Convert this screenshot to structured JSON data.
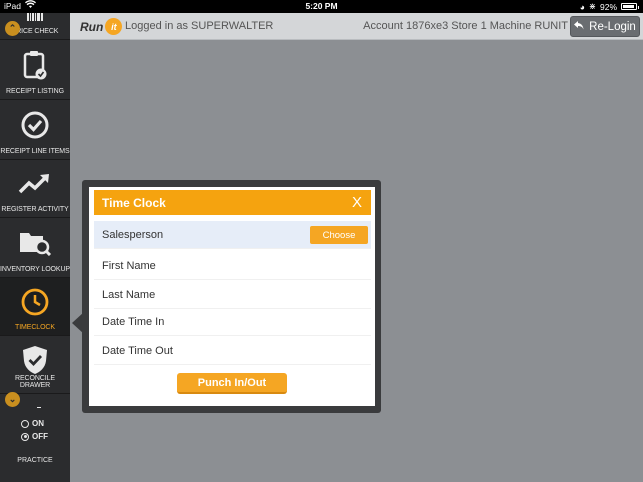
{
  "status_bar": {
    "carrier": "iPad",
    "time": "5:20 PM",
    "battery": "92%",
    "battery_level": 0.92
  },
  "header": {
    "logo_text": "Run",
    "logo_badge": "it",
    "logged_in": "Logged in as SUPERWALTER",
    "account": "Account 1876xe3 Store 1 Machine RUNIT",
    "relogin_label": "Re-Login"
  },
  "sidebar": {
    "items": [
      {
        "label": "Price Check",
        "icon": "barcode-icon"
      },
      {
        "label": "Receipt Listing",
        "icon": "clipboard-check-icon"
      },
      {
        "label": "Receipt Line Items",
        "icon": "check-circle-icon"
      },
      {
        "label": "Register Activity",
        "icon": "trend-up-icon"
      },
      {
        "label": "Inventory Lookup",
        "icon": "folder-search-icon"
      },
      {
        "label": "Timeclock",
        "icon": "clock-icon",
        "active": true
      },
      {
        "label": "Reconcile Drawer",
        "icon": "shield-check-icon"
      }
    ],
    "practice": {
      "on_label": "ON",
      "off_label": "OFF",
      "selected": "OFF",
      "label": "Practice"
    }
  },
  "dialog": {
    "title": "Time Clock",
    "close_label": "X",
    "fields": [
      {
        "label": "Salesperson",
        "button": "Choose"
      },
      {
        "label": "First Name"
      },
      {
        "label": "Last Name"
      },
      {
        "label": "Date Time In"
      },
      {
        "label": "Date Time Out"
      }
    ],
    "punch_label": "Punch In/Out"
  },
  "colors": {
    "accent": "#f5a623",
    "sidebar_bg": "#2b2c2e",
    "content_bg": "#8c8f93",
    "header_bg": "#d4d6d8"
  }
}
